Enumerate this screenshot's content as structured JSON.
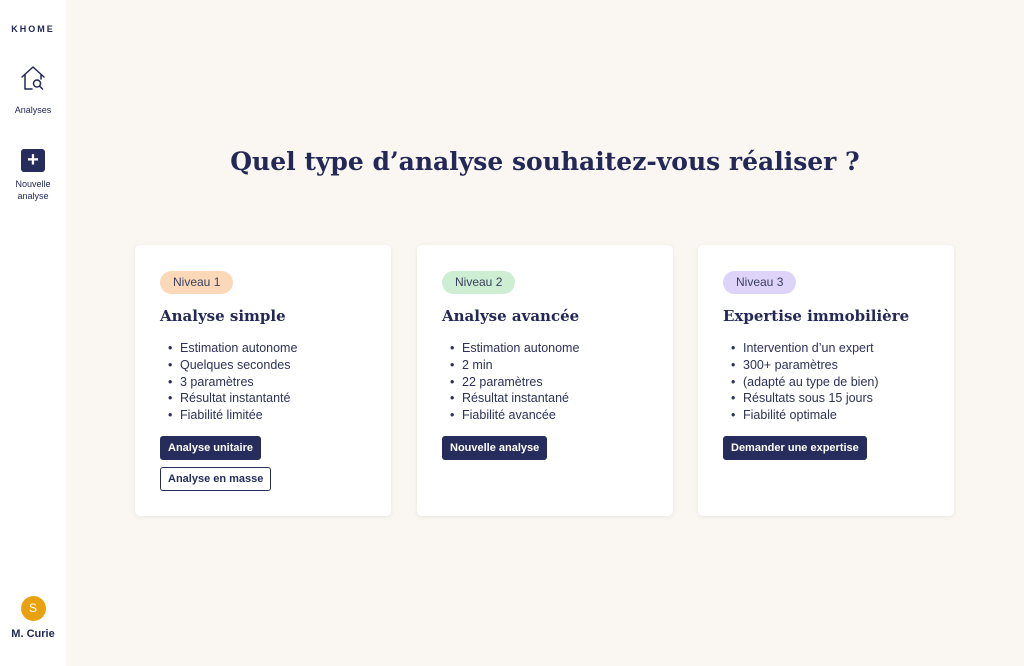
{
  "app": {
    "brand": "KHOME"
  },
  "sidebar": {
    "items": [
      {
        "label": "Analyses",
        "icon": "house-search-icon"
      },
      {
        "label": "Nouvelle analyse",
        "icon": "plus-icon"
      }
    ]
  },
  "user": {
    "initial": "S",
    "name": "M. Curie",
    "avatar_color": "#e9a20f"
  },
  "main": {
    "title": "Quel type d’analyse souhaitez-vous réaliser ?",
    "cards": [
      {
        "badge": "Niveau 1",
        "badge_color": "#fbd9b8",
        "title": "Analyse simple",
        "features": [
          "Estimation autonome",
          "Quelques secondes",
          "3 paramètres",
          "Résultat instantanté",
          "Fiabilité limitée"
        ],
        "buttons": [
          "Analyse unitaire",
          "Analyse en masse"
        ]
      },
      {
        "badge": "Niveau 2",
        "badge_color": "#cdeed3",
        "title": "Analyse avancée",
        "features": [
          "Estimation autonome",
          "2 min",
          "22 paramètres",
          "Résultat instantané",
          "Fiabilité avancée"
        ],
        "buttons": [
          "Nouvelle analyse"
        ]
      },
      {
        "badge": "Niveau 3",
        "badge_color": "#ded4f9",
        "title": "Expertise immobilière",
        "features": [
          "Intervention d’un expert",
          "300+ paramètres",
          "(adapté au type de bien)",
          "Résultats sous 15 jours",
          "Fiabilité optimale"
        ],
        "buttons": [
          "Demander une expertise"
        ]
      }
    ]
  },
  "colors": {
    "primary": "#262d5c",
    "background": "#faf6f1",
    "sidebar": "#ffffff"
  }
}
